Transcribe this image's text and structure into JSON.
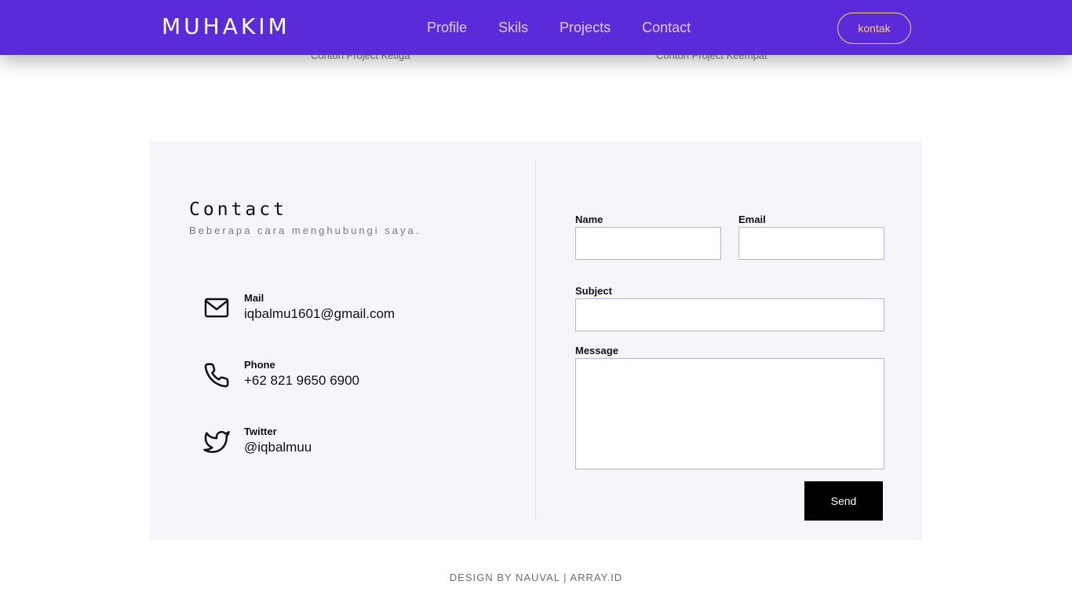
{
  "navbar": {
    "brand": "MUHAKIM",
    "links": [
      "Profile",
      "Skils",
      "Projects",
      "Contact"
    ],
    "cta": "kontak",
    "background": "#5b2bd9",
    "cta_color": "#f3d27a"
  },
  "projects": {
    "captions": [
      "Contoh Project Ketiga",
      "Contoh Project Keempat"
    ]
  },
  "contact": {
    "title": "Contact",
    "subtitle": "Beberapa cara menghubungi saya.",
    "items": [
      {
        "label": "Mail",
        "value": "iqbalmu1601@gmail.com",
        "icon": "mail-icon"
      },
      {
        "label": "Phone",
        "value": "+62 821 9650 6900",
        "icon": "phone-icon"
      },
      {
        "label": "Twitter",
        "value": "@iqbalmuu",
        "icon": "twitter-icon"
      }
    ]
  },
  "form": {
    "name_label": "Name",
    "email_label": "Email",
    "subject_label": "Subject",
    "message_label": "Message",
    "send_label": "Send",
    "name_value": "",
    "email_value": "",
    "subject_value": "",
    "message_value": ""
  },
  "footer": {
    "text": "DESIGN BY NAUVAL | ARRAY.ID"
  }
}
